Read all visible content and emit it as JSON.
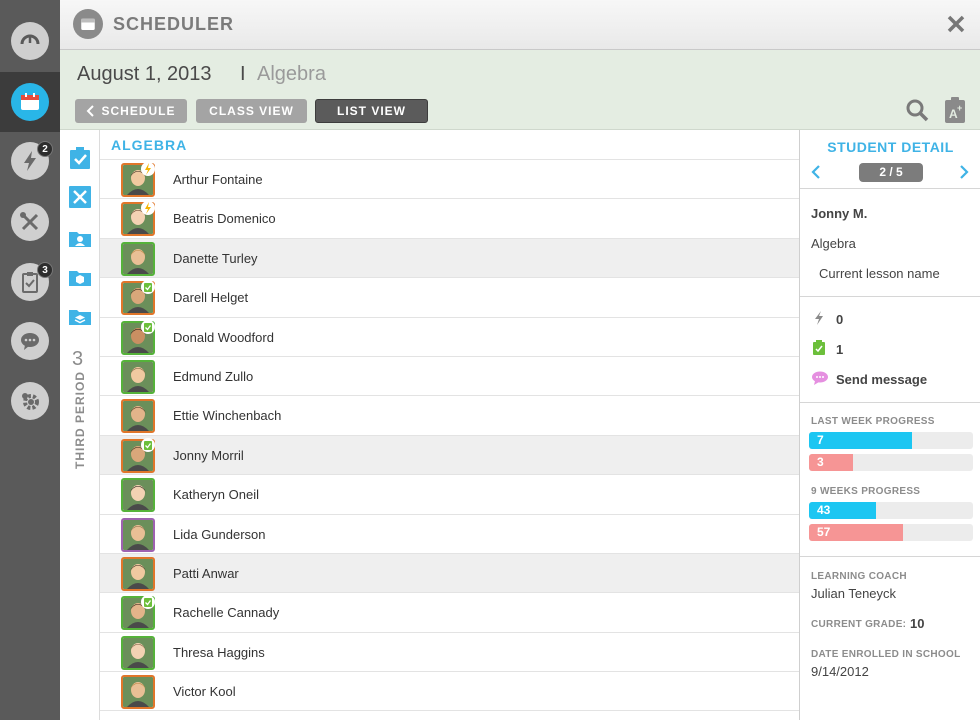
{
  "rail": {
    "badges": {
      "alerts": "2",
      "assignments": "3"
    }
  },
  "header": {
    "title": "SCHEDULER"
  },
  "subheader": {
    "date": "August 1, 2013",
    "separator": "I",
    "subject": "Algebra",
    "buttons": {
      "schedule": "SCHEDULE",
      "class_view": "CLASS VIEW",
      "list_view": "LIST VIEW"
    }
  },
  "subnav": {
    "period_number": "3",
    "period_label": "THIRD PERIOD"
  },
  "list": {
    "header": "ALGEBRA",
    "students": [
      {
        "name": "Arthur Fontaine",
        "status": "lightning-icon"
      },
      {
        "name": "Beatris Domenico",
        "status": "lightning-icon"
      },
      {
        "name": "Danette Turley",
        "status": ""
      },
      {
        "name": "Darell Helget",
        "status": "clipboard-icon"
      },
      {
        "name": "Donald Woodford",
        "status": "clipboard-icon"
      },
      {
        "name": "Edmund Zullo",
        "status": ""
      },
      {
        "name": "Ettie Winchenbach",
        "status": ""
      },
      {
        "name": "Jonny Morril",
        "status": "clipboard-icon"
      },
      {
        "name": "Katheryn Oneil",
        "status": ""
      },
      {
        "name": "Lida Gunderson",
        "status": ""
      },
      {
        "name": "Patti Anwar",
        "status": ""
      },
      {
        "name": "Rachelle Cannady",
        "status": "clipboard-icon"
      },
      {
        "name": "Thresa Haggins",
        "status": ""
      },
      {
        "name": "Victor Kool",
        "status": ""
      }
    ]
  },
  "detail": {
    "title": "STUDENT DETAIL",
    "pager": "2 / 5",
    "student_name": "Jonny M.",
    "subject": "Algebra",
    "lesson": "Current lesson name",
    "alerts_count": "0",
    "assignments_count": "1",
    "send_message": "Send message",
    "last_week_label": "LAST WEEK PROGRESS",
    "last_week": {
      "blue": "7",
      "pink": "3"
    },
    "nine_weeks_label": "9 WEEKS PROGRESS",
    "nine_weeks": {
      "blue": "43",
      "pink": "57"
    },
    "coach_label": "LEARNING COACH",
    "coach_name": "Julian Teneyck",
    "grade_label": "CURRENT GRADE:",
    "grade_value": "10",
    "enrolled_label": "DATE ENROLLED IN SCHOOL",
    "enrolled_date": "9/14/2012"
  },
  "colors": {
    "accent": "#3fb3e6",
    "blue_bar": "#1cc6f2",
    "pink_bar": "#f69595"
  }
}
